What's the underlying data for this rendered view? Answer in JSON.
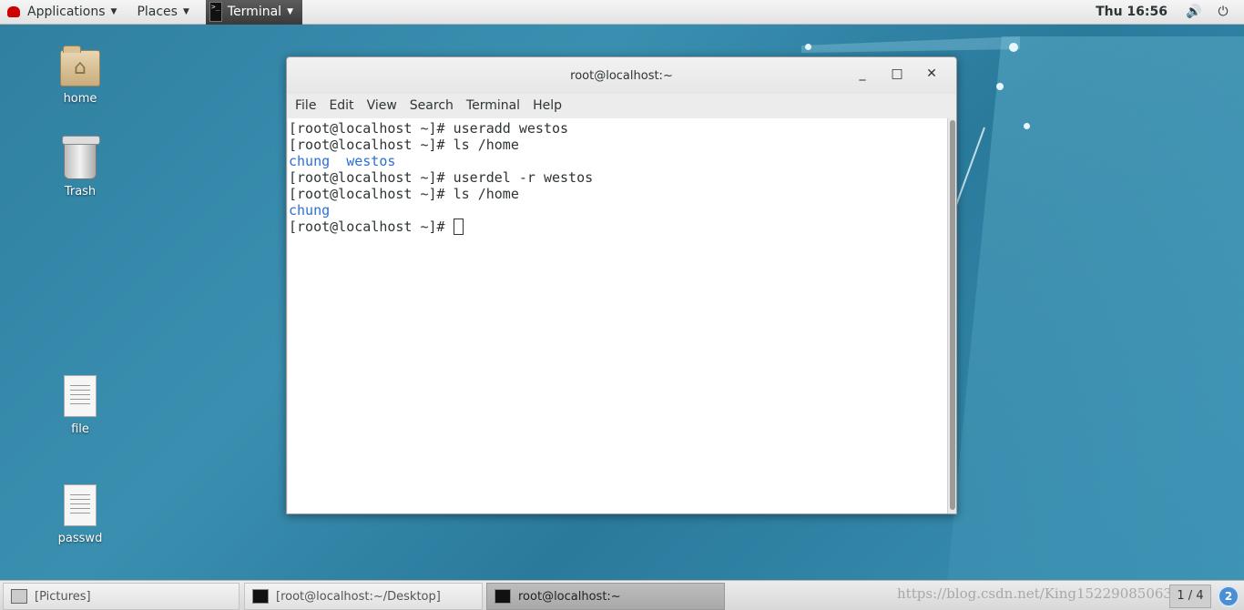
{
  "topbar": {
    "applications_label": "Applications",
    "places_label": "Places",
    "terminal_label": "Terminal",
    "clock": "Thu 16:56"
  },
  "desktop_icons": [
    {
      "label": "home",
      "icon": "home-folder-icon"
    },
    {
      "label": "Trash",
      "icon": "trash-icon"
    },
    {
      "label": "file",
      "icon": "text-file-icon"
    },
    {
      "label": "passwd",
      "icon": "text-file-icon"
    }
  ],
  "window": {
    "title": "root@localhost:~",
    "menu": [
      "File",
      "Edit",
      "View",
      "Search",
      "Terminal",
      "Help"
    ]
  },
  "terminal": {
    "prompt": "[root@localhost ~]# ",
    "lines": [
      {
        "type": "cmd",
        "text": "useradd westos"
      },
      {
        "type": "cmd",
        "text": "ls /home"
      },
      {
        "type": "out",
        "items": [
          "chung",
          "westos"
        ]
      },
      {
        "type": "cmd",
        "text": "userdel -r westos"
      },
      {
        "type": "cmd",
        "text": "ls /home"
      },
      {
        "type": "out",
        "items": [
          "chung"
        ]
      },
      {
        "type": "cmd",
        "text": ""
      }
    ],
    "dir_color": "#2a6fd6"
  },
  "taskbar": {
    "tasks": [
      {
        "label": "[Pictures]",
        "active": false
      },
      {
        "label": "[root@localhost:~/Desktop]",
        "active": false
      },
      {
        "label": "root@localhost:~",
        "active": true
      }
    ],
    "watermark": "https://blog.csdn.net/King15229085063",
    "pager": "1 / 4",
    "workspace_badge": "2"
  }
}
